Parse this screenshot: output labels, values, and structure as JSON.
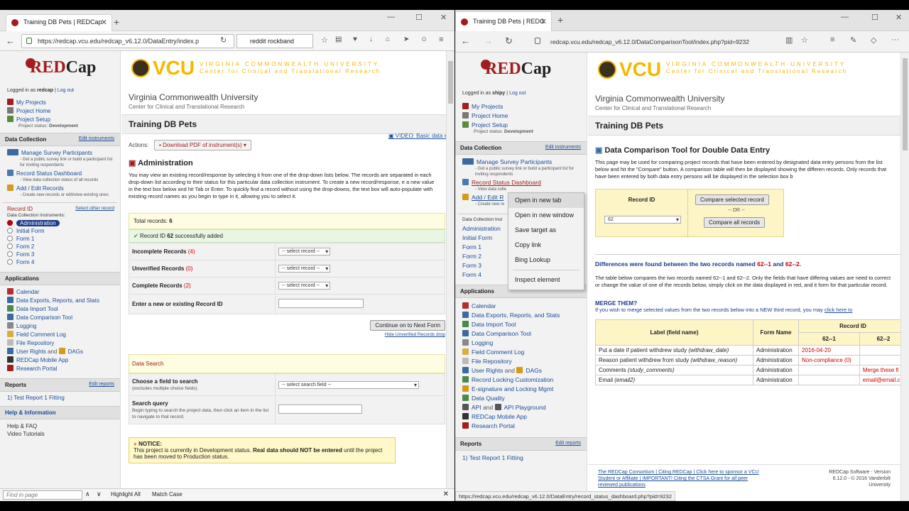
{
  "left": {
    "tab_title": "Training DB Pets | REDCap",
    "url": "https://redcap.vcu.edu/redcap_v6.12.0/DataEntry/index.p",
    "search": "reddit rockband",
    "logo_red": "RED",
    "logo_black": "Cap",
    "logged_in_prefix": "Logged in as",
    "username": "redcap",
    "logout": "Log out",
    "nav": [
      "My Projects",
      "Project Home",
      "Project Setup"
    ],
    "project_status_label": "Project status:",
    "project_status": "Development",
    "data_collection": {
      "header": "Data Collection",
      "edit_link": "Edit instruments",
      "items": [
        {
          "label": "Manage Survey Participants",
          "sub": "- Get a public survey link or build a participant list for inviting respondents"
        },
        {
          "label": "Record Status Dashboard",
          "sub": "- View data collection status of all records"
        },
        {
          "label": "Add / Edit Records",
          "sub": "- Create new records or edit/view existing ones"
        }
      ],
      "record_id_label": "Record ID",
      "select_other": "Select other record",
      "instruments_label": "Data Collection Instruments:",
      "instruments": [
        "Administration",
        "Initial Form",
        "Form 1",
        "Form 2",
        "Form 3",
        "Form 4"
      ]
    },
    "applications": {
      "header": "Applications",
      "items": [
        "Calendar",
        "Data Exports, Reports, and Stats",
        "Data Import Tool",
        "Data Comparison Tool",
        "Logging",
        "Field Comment Log",
        "File Repository",
        "User Rights",
        "and",
        "DAGs",
        "REDCap Mobile App",
        "Research Portal"
      ]
    },
    "reports": {
      "header": "Reports",
      "edit": "Edit reports",
      "items": [
        "Test Report 1 Fitting"
      ]
    },
    "help": {
      "header": "Help & Information",
      "items": [
        "Help & FAQ",
        "Video Tutorials"
      ]
    },
    "main": {
      "vcu": "VCU",
      "vcu_line1": "VIRGINIA COMMONWEALTH UNIVERSITY",
      "vcu_line2": "Center for Clinical and Translational Research",
      "univ": "Virginia Commonwealth University",
      "center": "Center for Clinical and Translational Research",
      "project_title": "Training DB Pets",
      "video_link": "VIDEO: Basic data e",
      "actions_label": "Actions:",
      "download_pdf": "Download PDF of instrument(s)",
      "section_title": "Administration",
      "para": "You may view an existing record/response by selecting it from one of the drop-down lists below. The records are separated in each drop-down list according to their status for this particular data collection instrument. To create a new record/response, e a new value in the text box below and hit Tab or Enter. To quickly find a record without using the drop-downs, the text box will auto-populate with existing record names as you begin to type in it, allowing you to select it.",
      "total_records_label": "Total records:",
      "total_records": "6",
      "success_prefix": "Record ID",
      "success_id": "62",
      "success_suffix": "successfully added",
      "rows": [
        {
          "label": "Incomplete Records",
          "count": "(4)"
        },
        {
          "label": "Unverified Records",
          "count": "(0)"
        },
        {
          "label": "Complete Records",
          "count": "(2)"
        }
      ],
      "select_placeholder": "-- select record --",
      "enter_record_label": "Enter a new or existing Record ID",
      "continue_btn": "Continue on to Next Form",
      "hide_unverified": "Hide Unverified Records drop",
      "data_search_header": "Data Search",
      "choose_field_label": "Choose a field to search",
      "choose_field_sub": "(excludes multiple choice fields)",
      "select_search_field": "-- select search field --",
      "search_query_label": "Search query",
      "search_query_sub": "Begin typing to search the project data, then click an item in the list to navigate to that record.",
      "notice_title": "NOTICE:",
      "notice_text1": "This project is currently in Development status.",
      "notice_bold": "Real data should NOT be entered",
      "notice_text2": "until the project has been moved to Production status."
    },
    "findbar": {
      "placeholder": "Find in page",
      "highlight": "Highlight All",
      "match": "Match Case"
    }
  },
  "right": {
    "tab_title": "Training DB Pets | REDC",
    "url": "redcap.vcu.edu/redcap_v6.12.0/DataComparisonTool/index.php?pid=9232",
    "username": "shipy",
    "logged_in_prefix": "Logged in as",
    "logout": "Log out",
    "nav": [
      "My Projects",
      "Project Home",
      "Project Setup"
    ],
    "project_status_label": "Project status:",
    "project_status": "Development",
    "dc_header": "Data Collection",
    "dc_edit": "Edit instruments",
    "dc_items": [
      {
        "label": "Manage Survey Participants",
        "sub": "- Get a public survey link or build a participant list for inviting respondents"
      },
      {
        "label": "Record Status Dashboard",
        "sub": "- View data colle"
      },
      {
        "label": "Add / Edit R",
        "sub": "- Create new re"
      }
    ],
    "instruments_label": "Data Collection Inst",
    "instruments": [
      "Administration",
      "Initial Form",
      "Form 1",
      "Form 2",
      "Form 3",
      "Form 4"
    ],
    "apps_header": "Applications",
    "apps": [
      "Calendar",
      "Data Exports, Reports, and Stats",
      "Data Import Tool",
      "Data Comparison Tool",
      "Logging",
      "Field Comment Log",
      "File Repository",
      "User Rights",
      "and",
      "DAGs",
      "Record Locking Customization",
      "E-signature and Locking Mgmt",
      "Data Quality",
      "API",
      "and",
      "API Playground",
      "REDCap Mobile App",
      "Research Portal"
    ],
    "reports_header": "Reports",
    "reports_edit": "Edit reports",
    "reports": [
      "Test Report 1 Fitting"
    ],
    "context_menu": [
      "Open in new tab",
      "Open in new window",
      "Save target as",
      "Copy link",
      "Bing Lookup",
      "Inspect element"
    ],
    "main": {
      "vcu": "VCU",
      "vcu_line1": "VIRGINIA COMMONWEALTH UNIVERSITY",
      "vcu_line2": "Center for Clinical and Translational Research",
      "univ": "Virginia Commonwealth University",
      "center": "Center for Clinical and Translational Research",
      "project_title": "Training DB Pets",
      "tool_title": "Data Comparison Tool for Double Data Entry",
      "para": "This page may be used for comparing project records that have been entered by designated data entry persons from the list below and hit the \"Compare\" button. A comparison table will then be displayed showing the differen records. Only records that have been entered by both data entry persons will be displayed in the selection box b",
      "record_id_label": "Record ID",
      "record_value": "62",
      "compare_selected": "Compare selected record",
      "or": "-- OR --",
      "compare_all": "Compare all records",
      "diff_prefix": "Differences were found between the two records named",
      "rec1": "62--1",
      "and": "and",
      "rec2": "62--2.",
      "table_para": "The table below compares the two records named 62--1 and 62--2. Only the fields that have differing values are need to correct or change the value of one of the records below, simply click on the data displayed in red, and it form for that particular record.",
      "merge_title": "MERGE THEM?",
      "merge_text": "If you wish to merge selected values from the two records below into a NEW third record, you may",
      "merge_link": "click here to",
      "th_label": "Label (field name)",
      "th_form": "Form Name",
      "th_record": "Record ID",
      "th_r1": "62--1",
      "th_r2": "62--2",
      "rows": [
        {
          "label": "Put a date if patient withdrew study",
          "field": "(withdraw_date)",
          "form": "Administration",
          "v1": "2016-04-20",
          "v2": ""
        },
        {
          "label": "Reason patient withdrew from study",
          "field": "(withdraw_reason)",
          "form": "Administration",
          "v1": "Non-compliance (0)",
          "v2": ""
        },
        {
          "label": "Comments",
          "field": "(study_comments)",
          "form": "Administration",
          "v1": "",
          "v2": "Merge these fi"
        },
        {
          "label": "Email",
          "field": "(email2)",
          "form": "Administration",
          "v1": "",
          "v2": "email@email.c"
        }
      ],
      "footer_l1": "The REDCap Consortium | Citing REDCap | Click here to sponsor a VCU",
      "footer_l2": "Student or Affiliate | IMPORTANT! Citing the CTSA Grant for all peer",
      "footer_l3": "reviewed publications",
      "footer_r1": "REDCap Software - Version",
      "footer_r2": "6.12.0 - © 2016 Vanderbilt",
      "footer_r3": "University"
    },
    "status_url": "https://redcap.vcu.edu/redcap_v6.12.0/DataEntry/record_status_dashboard.php?pid=9232"
  }
}
